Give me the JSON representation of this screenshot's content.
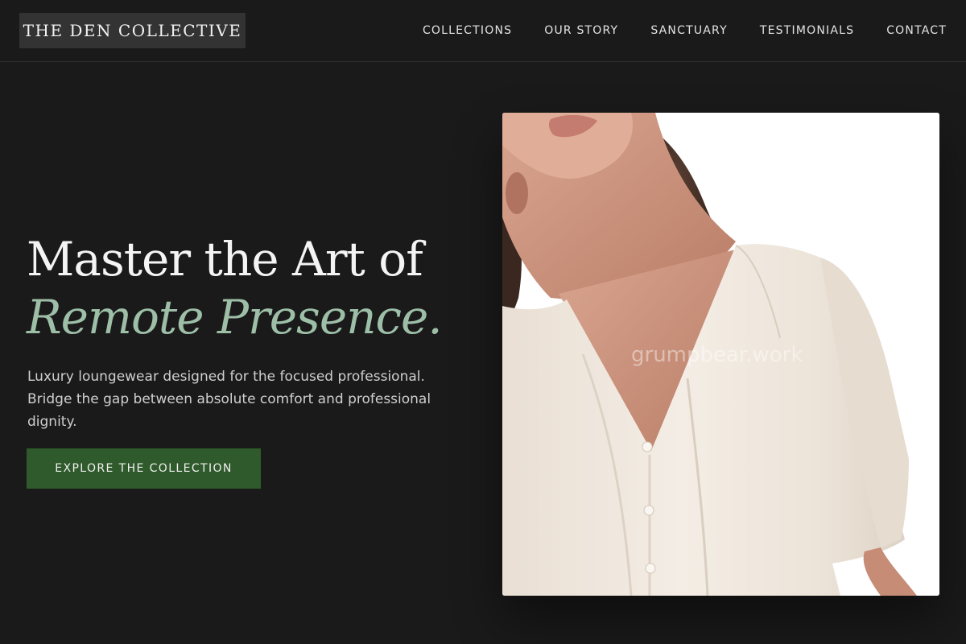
{
  "brand": {
    "name": "THE DEN COLLECTIVE"
  },
  "nav": {
    "items": [
      {
        "label": "COLLECTIONS"
      },
      {
        "label": "OUR STORY"
      },
      {
        "label": "SANCTUARY"
      },
      {
        "label": "TESTIMONIALS"
      },
      {
        "label": "CONTACT"
      }
    ]
  },
  "hero": {
    "headline_line1": "Master the Art of",
    "headline_line2": "Remote Presence.",
    "subtext": "Luxury loungewear designed for the focused professional. Bridge the gap between absolute comfort and professional dignity.",
    "cta_label": "EXPLORE THE COLLECTION",
    "image": {
      "subject": "model-in-cream-silk-blouse",
      "watermark": "grumpbear.work"
    }
  },
  "colors": {
    "background": "#1a1a1a",
    "accent_text": "#9dbfa8",
    "cta_background": "#2f5a2b",
    "logo_background": "#333333"
  }
}
